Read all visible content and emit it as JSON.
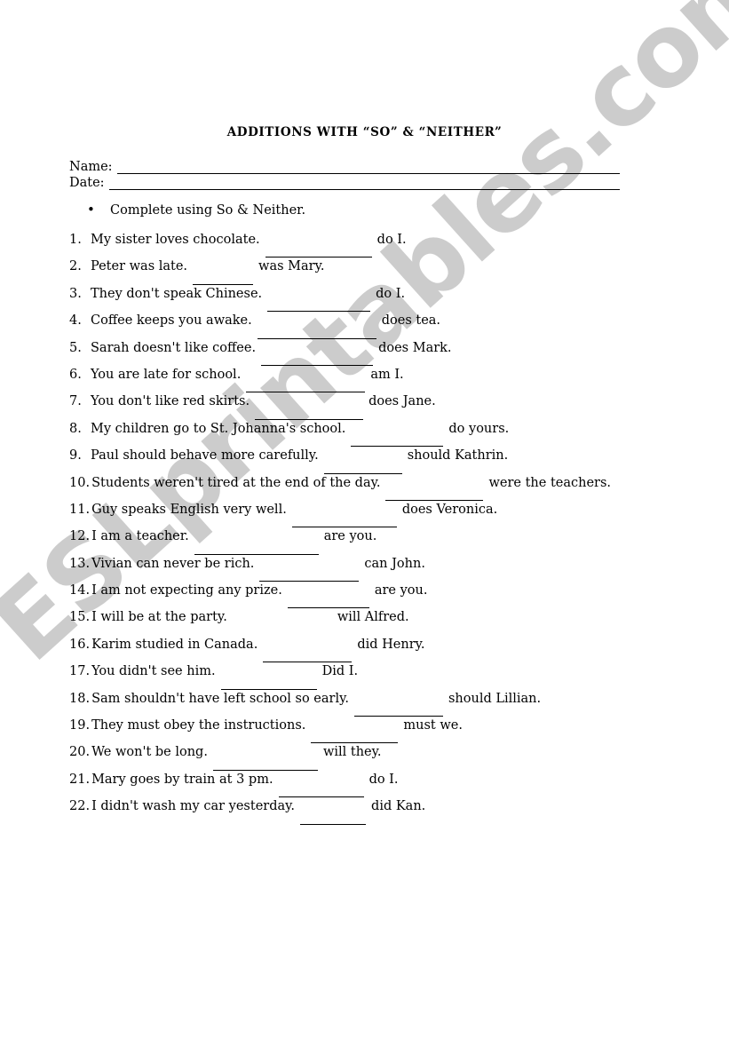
{
  "document": {
    "title": "ADDITIONS WITH “SO” & “NEITHER”",
    "watermark": "ESLprintables.com",
    "watermark_color": "#cccccc"
  },
  "header": {
    "name_label": "Name:",
    "date_label": "Date:"
  },
  "instruction": {
    "bullet": "•",
    "text": "Complete using So & Neither."
  },
  "questions": [
    {
      "num": "1.",
      "pre": "My sister loves chocolate.",
      "blank_width": 120,
      "blank_visible": true,
      "post": "do I."
    },
    {
      "num": "2.",
      "pre": "Peter was late.",
      "blank_width": 68,
      "blank_visible": true,
      "post": "was Mary."
    },
    {
      "num": "3.",
      "pre": "They don't speak Chinese.",
      "blank_width": 116,
      "blank_visible": true,
      "post": "do I."
    },
    {
      "num": "4.",
      "pre": "Coffee keeps you awake.",
      "blank_width": 134,
      "blank_visible": true,
      "post": "does tea."
    },
    {
      "num": "5.",
      "pre": "Sarah doesn't like coffee.",
      "blank_width": 126,
      "blank_visible": true,
      "post": "does Mark."
    },
    {
      "num": "6.",
      "pre": "You are late for school.",
      "blank_width": 134,
      "blank_visible": true,
      "post": "am I."
    },
    {
      "num": "7.",
      "pre": "You don't like red skirts.",
      "blank_width": 122,
      "blank_visible": true,
      "post": "does Jane."
    },
    {
      "num": "8.",
      "pre": "My children go to St. Johanna's school.",
      "blank_width": 104,
      "blank_visible": true,
      "post": "do yours."
    },
    {
      "num": "9.",
      "pre": "Paul should behave more carefully.",
      "blank_width": 88,
      "blank_visible": true,
      "post": "should Kathrin."
    },
    {
      "num": "10.",
      "pre": "Students weren't tired at the end of the day.",
      "blank_width": 110,
      "blank_visible": true,
      "post": "were the teachers."
    },
    {
      "num": "11.",
      "pre": "Guy speaks English very well.",
      "blank_width": 118,
      "blank_visible": true,
      "post": "does Veronica."
    },
    {
      "num": "12.",
      "pre": "I am a teacher.",
      "blank_width": 140,
      "blank_visible": true,
      "post": "are you."
    },
    {
      "num": "13.",
      "pre": "Vivian can never be rich.",
      "blank_width": 112,
      "blank_visible": true,
      "post": "can John."
    },
    {
      "num": "14.",
      "pre": "I am not expecting any prize.",
      "blank_width": 92,
      "blank_visible": true,
      "post": "are you."
    },
    {
      "num": "15.",
      "pre": "I will be at the party.",
      "blank_width": 112,
      "blank_visible": false,
      "post": "will Alfred."
    },
    {
      "num": "16.",
      "pre": "Karim studied in Canada.",
      "blank_width": 100,
      "blank_visible": true,
      "post": "did Henry."
    },
    {
      "num": "17.",
      "pre": "You didn't see him.",
      "blank_width": 108,
      "blank_visible": true,
      "post": "Did I."
    },
    {
      "num": "18.",
      "pre": "Sam shouldn't have left school so early.",
      "blank_width": 100,
      "blank_visible": true,
      "post": "should Lillian."
    },
    {
      "num": "19.",
      "pre": "They must obey the instructions.",
      "blank_width": 98,
      "blank_visible": true,
      "post": "must we."
    },
    {
      "num": "20.",
      "pre": "We won't be long.",
      "blank_width": 118,
      "blank_visible": true,
      "post": "will they."
    },
    {
      "num": "21.",
      "pre": "Mary goes by train at 3 pm.",
      "blank_width": 96,
      "blank_visible": true,
      "post": "do I."
    },
    {
      "num": "22.",
      "pre": "I didn't wash my car yesterday.",
      "blank_width": 74,
      "blank_visible": true,
      "post": "did Kan."
    }
  ]
}
